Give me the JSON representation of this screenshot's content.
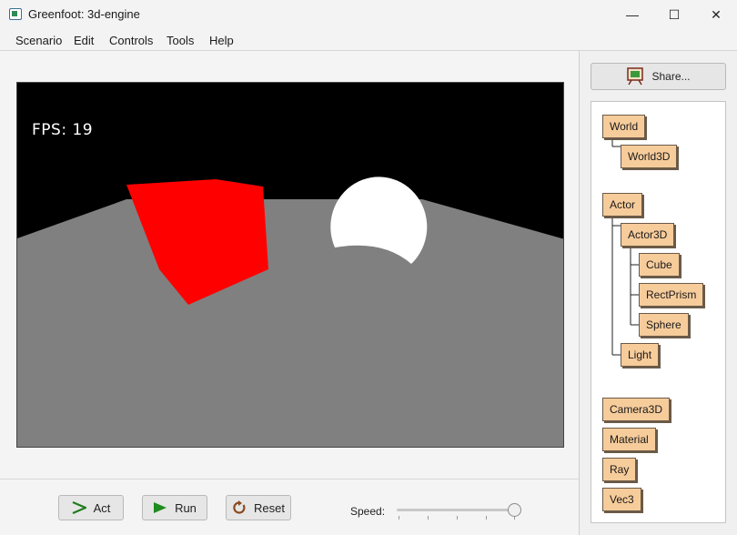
{
  "window": {
    "title": "Greenfoot: 3d-engine",
    "minimize": "—",
    "maximize": "☐",
    "close": "✕"
  },
  "menu": [
    "Scenario",
    "Edit",
    "Controls",
    "Tools",
    "Help"
  ],
  "world": {
    "fps_text": "FPS: 19",
    "colors": {
      "sky": "#000000",
      "floor": "#808080",
      "cube": "#ff0000",
      "sphere": "#ffffff"
    }
  },
  "controls": {
    "act_label": "Act",
    "run_label": "Run",
    "reset_label": "Reset",
    "speed_label": "Speed:",
    "speed_value": 1.0
  },
  "sidebar": {
    "share_label": "Share...",
    "classes": {
      "world": "World",
      "world3d": "World3D",
      "actor": "Actor",
      "actor3d": "Actor3D",
      "cube": "Cube",
      "rectprism": "RectPrism",
      "sphere": "Sphere",
      "light": "Light",
      "camera3d": "Camera3D",
      "material": "Material",
      "ray": "Ray",
      "vec3": "Vec3"
    }
  }
}
